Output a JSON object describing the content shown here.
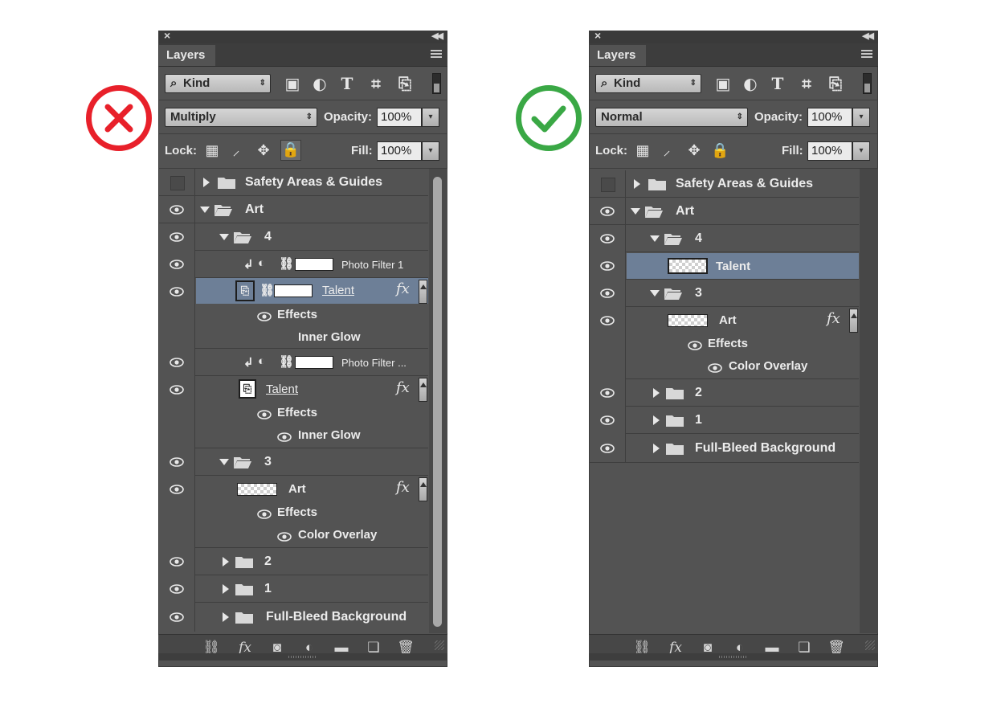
{
  "badges": {
    "wrong": "x-icon",
    "right": "check-icon",
    "wrong_color": "#e8202a",
    "right_color": "#3aa845"
  },
  "panels": [
    {
      "id": "wrong",
      "tab_label": "Layers",
      "filter_label": "Kind",
      "blend_mode": "Multiply",
      "opacity_label": "Opacity:",
      "opacity_value": "100%",
      "lock_label": "Lock:",
      "fill_label": "Fill:",
      "fill_value": "100%",
      "layers": [
        {
          "name": "Safety Areas & Guides"
        },
        {
          "name": "Art"
        },
        {
          "name": "4"
        },
        {
          "name": "Photo Filter 1"
        },
        {
          "name": "Talent",
          "effects_label": "Effects",
          "effect": "Inner Glow"
        },
        {
          "name": "Photo Filter ..."
        },
        {
          "name": "Talent",
          "effects_label": "Effects",
          "effect": "Inner Glow"
        },
        {
          "name": "3"
        },
        {
          "name": "Art",
          "effects_label": "Effects",
          "effect": "Color Overlay"
        },
        {
          "name": "2"
        },
        {
          "name": "1"
        },
        {
          "name": "Full-Bleed Background"
        }
      ]
    },
    {
      "id": "right",
      "tab_label": "Layers",
      "filter_label": "Kind",
      "blend_mode": "Normal",
      "opacity_label": "Opacity:",
      "opacity_value": "100%",
      "lock_label": "Lock:",
      "fill_label": "Fill:",
      "fill_value": "100%",
      "layers": [
        {
          "name": "Safety Areas & Guides"
        },
        {
          "name": "Art"
        },
        {
          "name": "4"
        },
        {
          "name": "Talent"
        },
        {
          "name": "3"
        },
        {
          "name": "Art",
          "effects_label": "Effects",
          "effect": "Color Overlay"
        },
        {
          "name": "2"
        },
        {
          "name": "1"
        },
        {
          "name": "Full-Bleed Background"
        }
      ]
    }
  ],
  "colors": {
    "panel_bg": "#535353",
    "selected_row": "#6d7f97"
  }
}
